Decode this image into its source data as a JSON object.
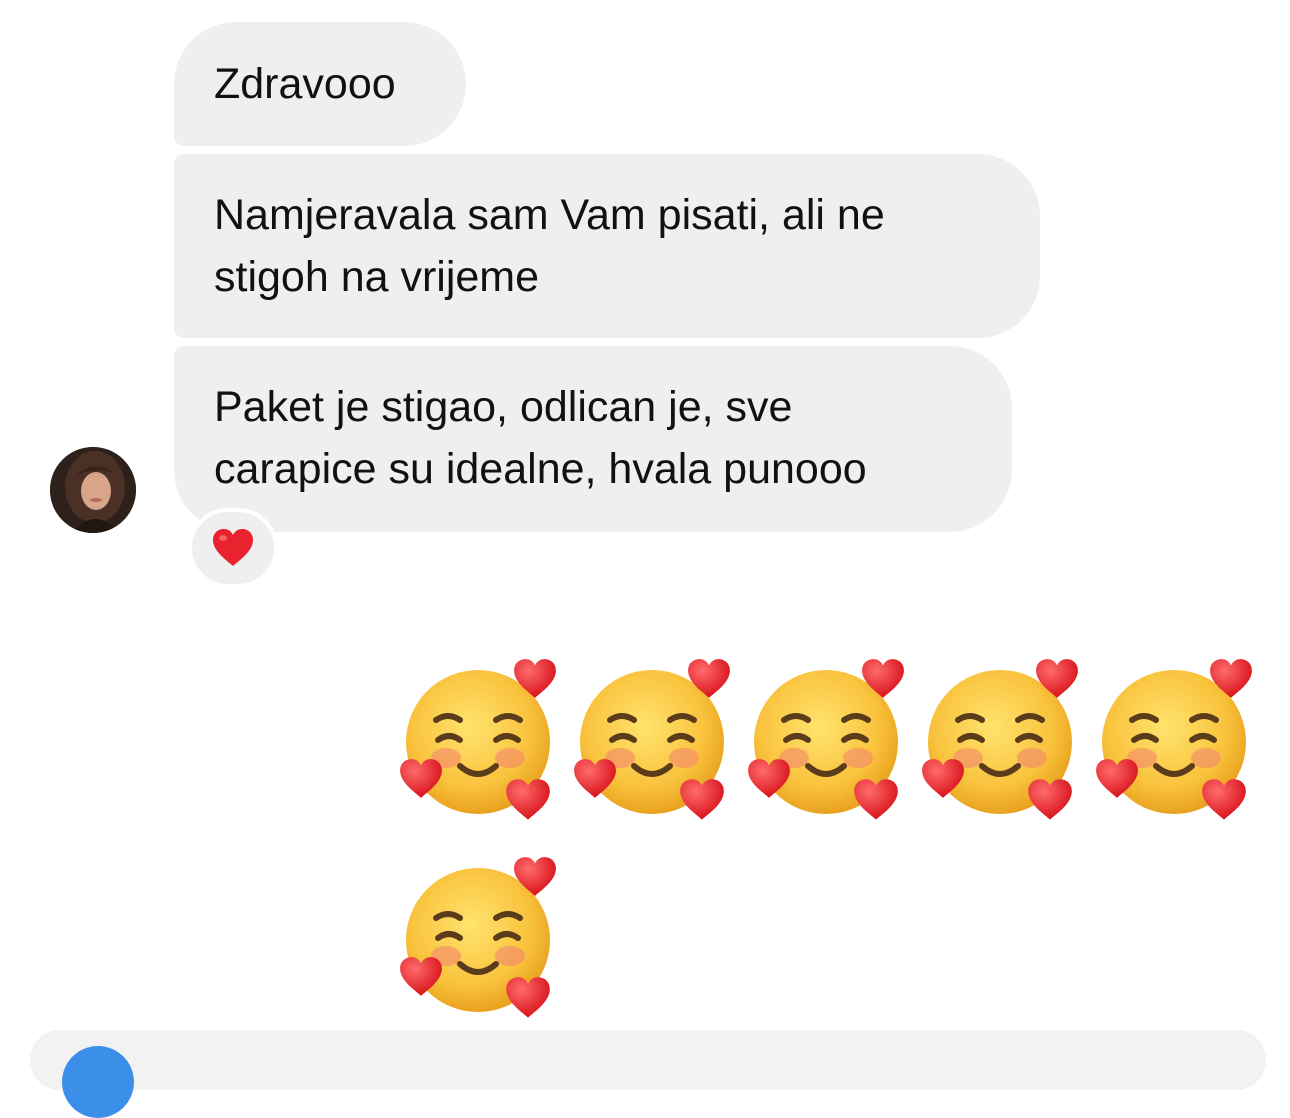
{
  "messages": {
    "m1": "Zdravooo",
    "m2": {
      "line1": "Namjeravala sam Vam pisati, ali ne",
      "line2": "stigoh na vrijeme"
    },
    "m3": {
      "line1": "Paket je stigao, odlican je, sve",
      "line2": "carapice su idealne, hvala punooo"
    }
  },
  "reaction": {
    "icon": "red-heart-icon",
    "color": "#e8232d"
  },
  "sent_emojis": {
    "icon": "smiling-face-with-hearts-icon",
    "count": 6
  },
  "colors": {
    "incoming_bubble": "#efefef",
    "accent": "#3b8fe8"
  }
}
